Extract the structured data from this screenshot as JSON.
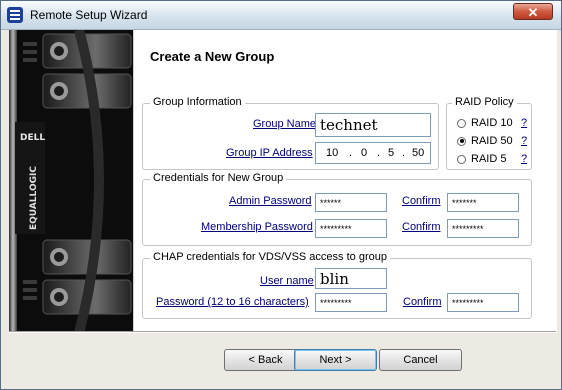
{
  "window": {
    "title": "Remote Setup Wizard",
    "close_glyph": "✕"
  },
  "banner": {
    "brand_top": "DELL",
    "brand_vertical": "EQUALLOGIC"
  },
  "page": {
    "heading": "Create a New Group"
  },
  "group_info": {
    "legend": "Group Information",
    "group_name_label": "Group Name",
    "group_name_value": "technet",
    "group_ip_label": "Group IP Address",
    "ip": [
      "10",
      "0",
      "5",
      "50"
    ]
  },
  "raid": {
    "legend": "RAID Policy",
    "options": [
      {
        "label": "RAID 10",
        "help": "?",
        "selected": false
      },
      {
        "label": "RAID 50",
        "help": "?",
        "selected": true
      },
      {
        "label": "RAID 5",
        "help": "?",
        "selected": false
      }
    ]
  },
  "credentials": {
    "legend": "Credentials for New Group",
    "admin_label": "Admin Password",
    "admin_value": "******",
    "admin_confirm_label": "Confirm",
    "admin_confirm_value": "*******",
    "membership_label": "Membership Password",
    "membership_value": "*********",
    "membership_confirm_label": "Confirm",
    "membership_confirm_value": "*********"
  },
  "chap": {
    "legend": "CHAP credentials for VDS/VSS access to group",
    "user_label": "User name",
    "user_value": "blin",
    "password_label": "Password (12 to 16 characters)",
    "password_value": "*********",
    "confirm_label": "Confirm",
    "confirm_value": "*********"
  },
  "buttons": {
    "back": "< Back",
    "next": "Next >",
    "cancel": "Cancel"
  },
  "colors": {
    "link": "#00007b",
    "close": "#cf5a3f",
    "panel": "#eceae2"
  }
}
